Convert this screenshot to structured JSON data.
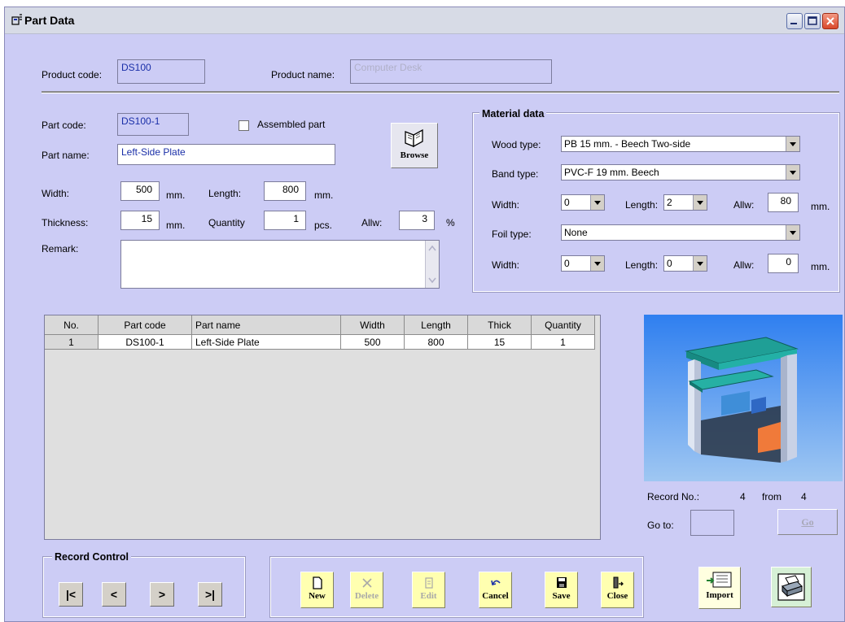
{
  "window": {
    "title": "Part Data"
  },
  "product": {
    "code_label": "Product code:",
    "code_value": "DS100",
    "name_label": "Product name:",
    "name_value": "Computer Desk"
  },
  "part": {
    "code_label": "Part code:",
    "code_value": "DS100-1",
    "assembled_label": "Assembled part",
    "name_label": "Part name:",
    "name_value": "Left-Side Plate",
    "width_label": "Width:",
    "width_value": "500",
    "width_unit": "mm.",
    "length_label": "Length:",
    "length_value": "800",
    "length_unit": "mm.",
    "thickness_label": "Thickness:",
    "thickness_value": "15",
    "thickness_unit": "mm.",
    "quantity_label": "Quantity",
    "quantity_value": "1",
    "quantity_unit": "pcs.",
    "allw_label": "Allw:",
    "allw_value": "3",
    "allw_unit": "%",
    "remark_label": "Remark:",
    "remark_value": "",
    "browse_label": "Browse"
  },
  "material": {
    "title": "Material data",
    "wood_label": "Wood type:",
    "wood_value": "PB 15 mm. - Beech Two-side",
    "band_label": "Band type:",
    "band_value": "PVC-F 19 mm. Beech",
    "band_width_label": "Width:",
    "band_width_value": "0",
    "band_length_label": "Length:",
    "band_length_value": "2",
    "band_allw_label": "Allw:",
    "band_allw_value": "80",
    "band_unit": "mm.",
    "foil_label": "Foil type:",
    "foil_value": "None",
    "foil_width_label": "Width:",
    "foil_width_value": "0",
    "foil_length_label": "Length:",
    "foil_length_value": "0",
    "foil_allw_label": "Allw:",
    "foil_allw_value": "0",
    "foil_unit": "mm."
  },
  "table": {
    "headers": [
      "No.",
      "Part code",
      "Part name",
      "Width",
      "Length",
      "Thick",
      "Quantity"
    ],
    "rows": [
      [
        "1",
        "DS100-1",
        "Left-Side Plate",
        "500",
        "800",
        "15",
        "1"
      ]
    ]
  },
  "record": {
    "no_label": "Record No.:",
    "no_value": "4",
    "from_label": "from",
    "from_value": "4",
    "goto_label": "Go to:",
    "goto_value": "",
    "go_label": "Go"
  },
  "record_control": {
    "title": "Record Control",
    "first": "|<",
    "prev": "<",
    "next": ">",
    "last": ">|"
  },
  "toolbar": {
    "new": "New",
    "delete": "Delete",
    "edit": "Edit",
    "cancel": "Cancel",
    "save": "Save",
    "close": "Close",
    "import": "Import"
  },
  "icons": [
    "app-icon",
    "minimize-icon",
    "maximize-icon",
    "close-icon",
    "book-icon",
    "new-doc-icon",
    "delete-x-icon",
    "edit-icon",
    "undo-icon",
    "floppy-icon",
    "exit-door-icon",
    "import-icon",
    "printer-icon"
  ],
  "colors": {
    "window_bg": "#ccccf5",
    "toolbar_btn": "#ffffb0",
    "field_text": "#1a2fa8"
  }
}
